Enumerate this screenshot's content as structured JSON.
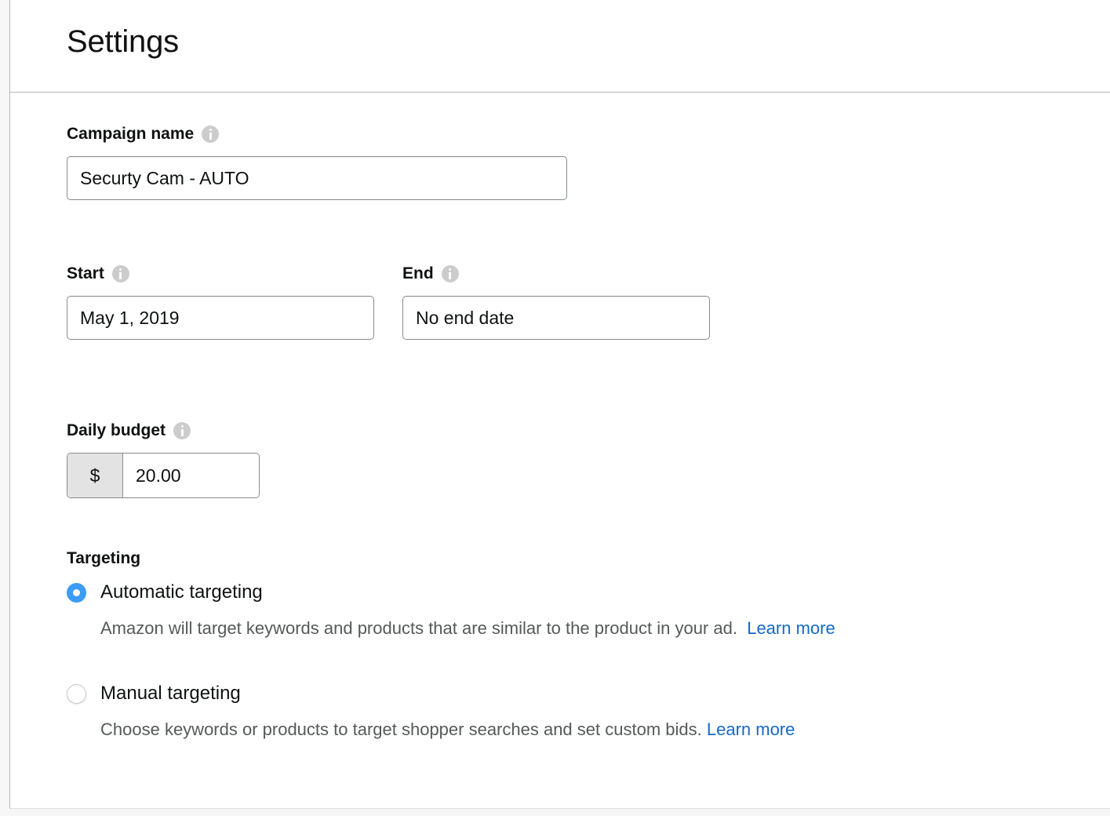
{
  "header": {
    "title": "Settings"
  },
  "form": {
    "campaign_name": {
      "label": "Campaign name",
      "info_icon": "info-icon",
      "value": "Securty Cam - AUTO",
      "placeholder": "Campaign name"
    },
    "start": {
      "label": "Start",
      "info_icon": "info-icon",
      "value": "May 1, 2019"
    },
    "end": {
      "label": "End",
      "info_icon": "info-icon",
      "value": "No end date"
    },
    "daily_budget": {
      "label": "Daily budget",
      "info_icon": "info-icon",
      "currency_symbol": "$",
      "value": "20.00"
    },
    "targeting": {
      "label": "Targeting",
      "selected": "automatic",
      "options": [
        {
          "id": "automatic",
          "label": "Automatic targeting",
          "description": "Amazon will target keywords and products that are similar to the product in your ad.",
          "link_label": "Learn more",
          "selected": true
        },
        {
          "id": "manual",
          "label": "Manual targeting",
          "description": "Choose keywords or products to target shopper searches and set custom bids.",
          "link_label": "Learn more",
          "selected": false
        }
      ]
    }
  },
  "colors": {
    "link": "#1669c6",
    "radio_selected": "#3d9bf5",
    "input_border": "#888c8c",
    "prefix_background": "#e3e3e3",
    "info_icon": "#cccccc",
    "text_primary": "#0f1111",
    "text_secondary": "#565959",
    "page_background": "#f7f7f7"
  }
}
